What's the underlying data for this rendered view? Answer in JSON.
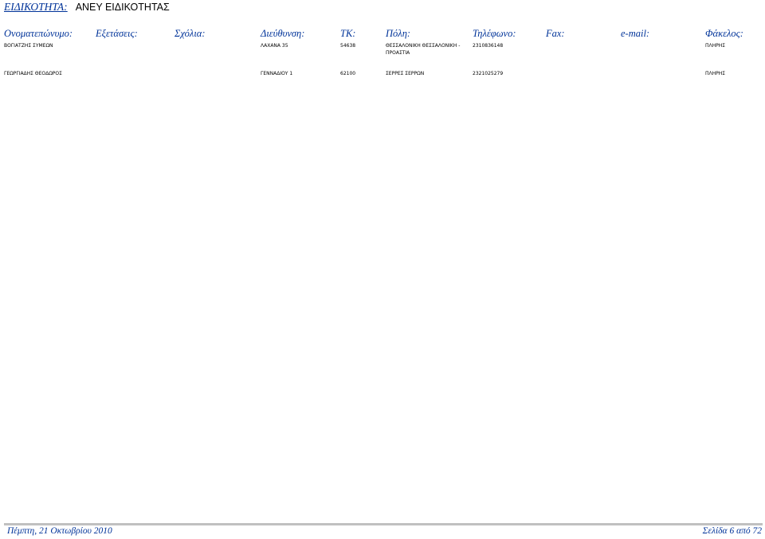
{
  "title": {
    "label": "ΕΙΔΙΚΟΤΗΤΑ:",
    "value": "ΑΝΕΥ ΕΙΔΙΚΟΤΗΤΑΣ"
  },
  "columns": {
    "name": "Ονοματεπώνυμο:",
    "exams": "Εξετάσεις:",
    "comments": "Σχόλια:",
    "address": "Διεύθυνση:",
    "tk": "ΤΚ:",
    "city": "Πόλη:",
    "phone": "Τηλέφωνο:",
    "fax": "Fax:",
    "email": "e-mail:",
    "folder": "Φάκελος:"
  },
  "rows": [
    {
      "name": "ΒΟΓΙΑΤΖΗΣ ΣΥΜΕΩΝ",
      "address": "ΛΑΧΑΝΑ 35",
      "tk": "54638",
      "city": "ΘΕΣΣΑΛΟΝΙΚΗ ΘΕΣΣΑΛΟΝΙΚΗ - ΠΡΟΑΣΤΙΑ",
      "phone": "2310836148",
      "folder": "ΠΛΗΡΗΣ"
    },
    {
      "name": "ΓΕΩΡΓΙΑΔΗΣ ΘΕΟΔΩΡΟΣ",
      "address": "ΓΕΝΝΑΔΙΟΥ 1",
      "tk": "62100",
      "city": "ΣΕΡΡΕΣ ΣΕΡΡΩΝ",
      "phone": "2321025279",
      "folder": "ΠΛΗΡΗΣ"
    }
  ],
  "footer": {
    "date": "Πέμπτη, 21 Οκτωβρίου 2010",
    "page": "Σελίδα 6 από 72"
  }
}
